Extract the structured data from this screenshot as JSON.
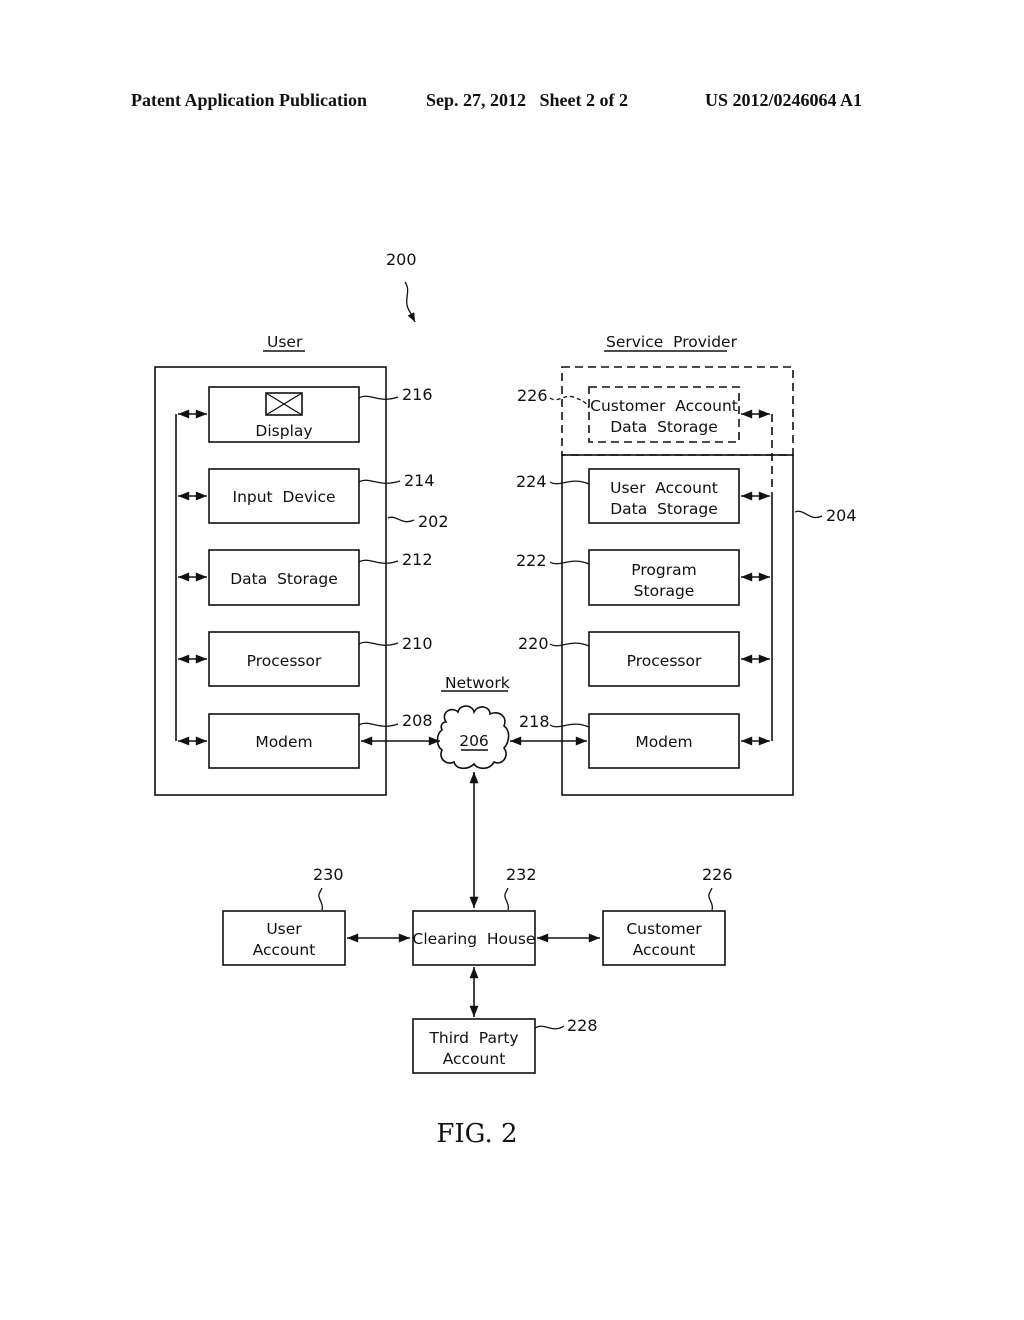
{
  "header": {
    "publication": "Patent Application Publication",
    "date_sheet": "Sep. 27, 2012   Sheet 2 of 2",
    "number": "US 2012/0246064 A1"
  },
  "figure": {
    "ref": "200",
    "caption": "FIG. 2",
    "user_section": {
      "title": "User",
      "ref": "202",
      "components": [
        {
          "label": [
            "Display"
          ],
          "ref": "216",
          "icon": "display-icon"
        },
        {
          "label": [
            "Input  Device"
          ],
          "ref": "214"
        },
        {
          "label": [
            "Data  Storage"
          ],
          "ref": "212"
        },
        {
          "label": [
            "Processor"
          ],
          "ref": "210"
        },
        {
          "label": [
            "Modem"
          ],
          "ref": "208"
        }
      ]
    },
    "provider_section": {
      "title": "Service  Provider",
      "ref": "204",
      "optional_component": {
        "label": [
          "Customer  Account",
          "Data  Storage"
        ],
        "ref": "226"
      },
      "components": [
        {
          "label": [
            "User  Account",
            "Data  Storage"
          ],
          "ref": "224"
        },
        {
          "label": [
            "Program",
            "Storage"
          ],
          "ref": "222"
        },
        {
          "label": [
            "Processor"
          ],
          "ref": "220"
        },
        {
          "label": [
            "Modem"
          ],
          "ref": "218"
        }
      ]
    },
    "network": {
      "title": "Network",
      "ref": "206"
    },
    "accounts": {
      "user_account": {
        "label": [
          "User",
          "Account"
        ],
        "ref": "230"
      },
      "clearing_house": {
        "label": [
          "Clearing  House"
        ],
        "ref": "232"
      },
      "customer_account": {
        "label": [
          "Customer",
          "Account"
        ],
        "ref": "226"
      },
      "third_party_account": {
        "label": [
          "Third  Party",
          "Account"
        ],
        "ref": "228"
      }
    }
  }
}
